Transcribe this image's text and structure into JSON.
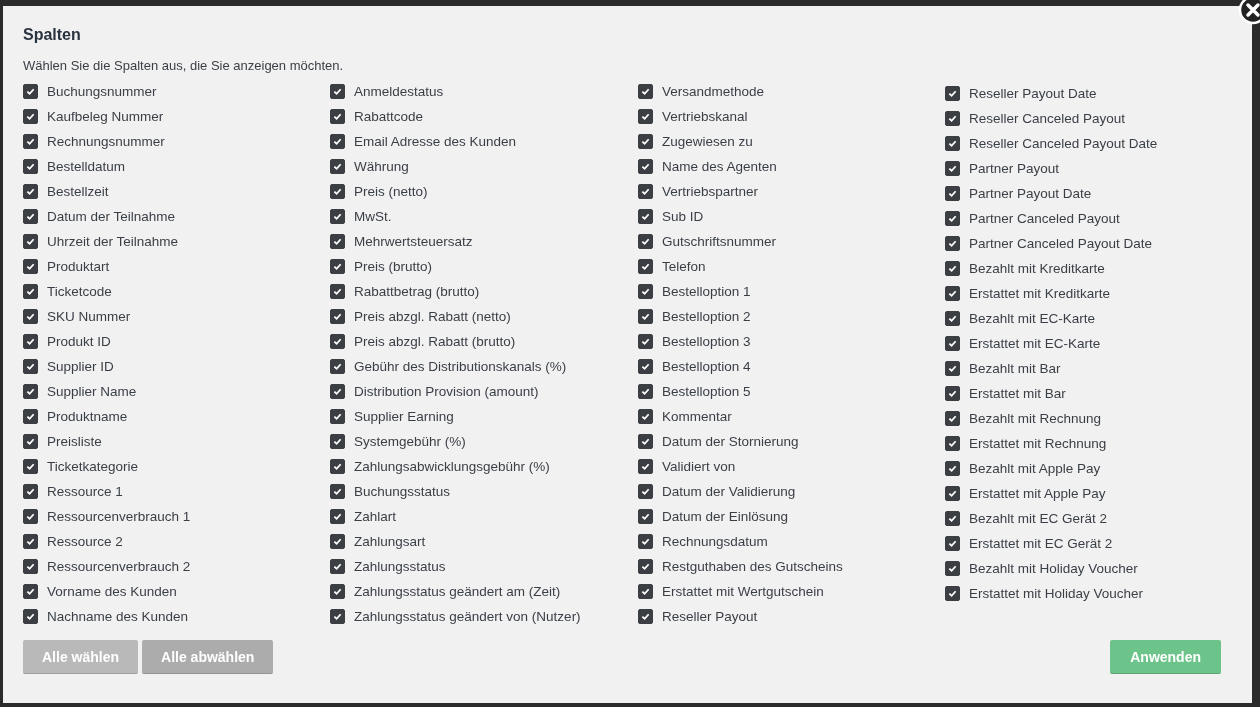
{
  "dialog": {
    "title": "Spalten",
    "subtitle": "Wählen Sie die Spalten aus, die Sie anzeigen möchten.",
    "columns": [
      [
        {
          "label": "Buchungsnummer",
          "checked": true
        },
        {
          "label": "Kaufbeleg Nummer",
          "checked": true
        },
        {
          "label": "Rechnungsnummer",
          "checked": true
        },
        {
          "label": "Bestelldatum",
          "checked": true
        },
        {
          "label": "Bestellzeit",
          "checked": true
        },
        {
          "label": "Datum der Teilnahme",
          "checked": true
        },
        {
          "label": "Uhrzeit der Teilnahme",
          "checked": true
        },
        {
          "label": "Produktart",
          "checked": true
        },
        {
          "label": "Ticketcode",
          "checked": true
        },
        {
          "label": "SKU Nummer",
          "checked": true
        },
        {
          "label": "Produkt ID",
          "checked": true
        },
        {
          "label": "Supplier ID",
          "checked": true
        },
        {
          "label": "Supplier Name",
          "checked": true
        },
        {
          "label": "Produktname",
          "checked": true
        },
        {
          "label": "Preisliste",
          "checked": true
        },
        {
          "label": "Ticketkategorie",
          "checked": true
        },
        {
          "label": "Ressource 1",
          "checked": true
        },
        {
          "label": "Ressourcenverbrauch 1",
          "checked": true
        },
        {
          "label": "Ressource 2",
          "checked": true
        },
        {
          "label": "Ressourcenverbrauch 2",
          "checked": true
        },
        {
          "label": "Vorname des Kunden",
          "checked": true
        },
        {
          "label": "Nachname des Kunden",
          "checked": true
        }
      ],
      [
        {
          "label": "Anmeldestatus",
          "checked": true
        },
        {
          "label": "Rabattcode",
          "checked": true
        },
        {
          "label": "Email Adresse des Kunden",
          "checked": true
        },
        {
          "label": "Währung",
          "checked": true
        },
        {
          "label": "Preis (netto)",
          "checked": true
        },
        {
          "label": "MwSt.",
          "checked": true
        },
        {
          "label": "Mehrwertsteuersatz",
          "checked": true
        },
        {
          "label": "Preis (brutto)",
          "checked": true
        },
        {
          "label": "Rabattbetrag (brutto)",
          "checked": true
        },
        {
          "label": "Preis abzgl. Rabatt (netto)",
          "checked": true
        },
        {
          "label": "Preis abzgl. Rabatt (brutto)",
          "checked": true
        },
        {
          "label": "Gebühr des Distributionskanals (%)",
          "checked": true
        },
        {
          "label": "Distribution Provision (amount)",
          "checked": true
        },
        {
          "label": "Supplier Earning",
          "checked": true
        },
        {
          "label": "Systemgebühr (%)",
          "checked": true
        },
        {
          "label": "Zahlungsabwicklungsgebühr (%)",
          "checked": true
        },
        {
          "label": "Buchungsstatus",
          "checked": true
        },
        {
          "label": "Zahlart",
          "checked": true
        },
        {
          "label": "Zahlungsart",
          "checked": true
        },
        {
          "label": "Zahlungsstatus",
          "checked": true
        },
        {
          "label": "Zahlungsstatus geändert am (Zeit)",
          "checked": true
        },
        {
          "label": "Zahlungsstatus geändert von (Nutzer)",
          "checked": true
        }
      ],
      [
        {
          "label": "Versandmethode",
          "checked": true
        },
        {
          "label": "Vertriebskanal",
          "checked": true
        },
        {
          "label": "Zugewiesen zu",
          "checked": true
        },
        {
          "label": "Name des Agenten",
          "checked": true
        },
        {
          "label": "Vertriebspartner",
          "checked": true
        },
        {
          "label": "Sub ID",
          "checked": true
        },
        {
          "label": "Gutschriftsnummer",
          "checked": true
        },
        {
          "label": "Telefon",
          "checked": true
        },
        {
          "label": "Bestelloption 1",
          "checked": true
        },
        {
          "label": "Bestelloption 2",
          "checked": true
        },
        {
          "label": "Bestelloption 3",
          "checked": true
        },
        {
          "label": "Bestelloption 4",
          "checked": true
        },
        {
          "label": "Bestelloption 5",
          "checked": true
        },
        {
          "label": "Kommentar",
          "checked": true
        },
        {
          "label": "Datum der Stornierung",
          "checked": true
        },
        {
          "label": "Validiert von",
          "checked": true
        },
        {
          "label": "Datum der Validierung",
          "checked": true
        },
        {
          "label": "Datum der Einlösung",
          "checked": true
        },
        {
          "label": "Rechnungsdatum",
          "checked": true
        },
        {
          "label": "Restguthaben des Gutscheins",
          "checked": true
        },
        {
          "label": "Erstattet mit Wertgutschein",
          "checked": true
        },
        {
          "label": "Reseller Payout",
          "checked": true
        }
      ],
      [
        {
          "label": "Reseller Payout Date",
          "checked": true
        },
        {
          "label": "Reseller Canceled Payout",
          "checked": true
        },
        {
          "label": "Reseller Canceled Payout Date",
          "checked": true
        },
        {
          "label": "Partner Payout",
          "checked": true
        },
        {
          "label": "Partner Payout Date",
          "checked": true
        },
        {
          "label": "Partner Canceled Payout",
          "checked": true
        },
        {
          "label": "Partner Canceled Payout Date",
          "checked": true
        },
        {
          "label": "Bezahlt mit Kreditkarte",
          "checked": true
        },
        {
          "label": "Erstattet mit Kreditkarte",
          "checked": true
        },
        {
          "label": "Bezahlt mit EC-Karte",
          "checked": true
        },
        {
          "label": "Erstattet mit EC-Karte",
          "checked": true
        },
        {
          "label": "Bezahlt mit Bar",
          "checked": true
        },
        {
          "label": "Erstattet mit Bar",
          "checked": true
        },
        {
          "label": "Bezahlt mit Rechnung",
          "checked": true
        },
        {
          "label": "Erstattet mit Rechnung",
          "checked": true
        },
        {
          "label": "Bezahlt mit Apple Pay",
          "checked": true
        },
        {
          "label": "Erstattet mit Apple Pay",
          "checked": true
        },
        {
          "label": "Bezahlt mit EC Gerät 2",
          "checked": true
        },
        {
          "label": "Erstattet mit EC Gerät 2",
          "checked": true
        },
        {
          "label": "Bezahlt mit Holiday Voucher",
          "checked": true
        },
        {
          "label": "Erstattet mit Holiday Voucher",
          "checked": true
        }
      ]
    ],
    "buttons": [
      {
        "label": "Alle wählen",
        "kind": "secondary"
      },
      {
        "label": "Alle abwählen",
        "kind": "secondary"
      },
      {
        "label": "Anwenden",
        "kind": "primary"
      }
    ]
  }
}
